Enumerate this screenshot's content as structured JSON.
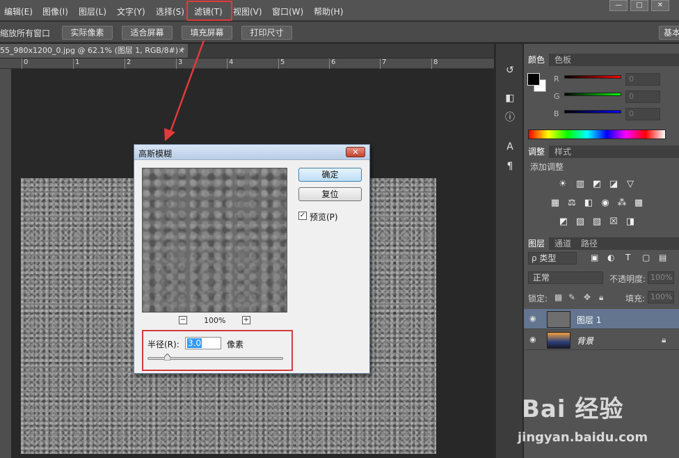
{
  "menu": {
    "items": [
      "编辑(E)",
      "图像(I)",
      "图层(L)",
      "文字(Y)",
      "选择(S)",
      "滤镜(T)",
      "视图(V)",
      "窗口(W)",
      "帮助(H)"
    ],
    "window_controls": [
      "—",
      "□",
      "✕"
    ]
  },
  "options_bar": {
    "truncated_label": "缩放所有窗口",
    "buttons": [
      "实际像素",
      "适合屏幕",
      "填充屏幕",
      "打印尺寸"
    ],
    "right_button": "基本"
  },
  "document": {
    "tab_title": "55_980x1200_0.jpg @ 62.1% (图层 1, RGB/8#) *",
    "tab_close": "×",
    "ruler_labels": [
      "0",
      "1",
      "2",
      "3",
      "4",
      "5",
      "6",
      "7",
      "8"
    ]
  },
  "dock_icons": [
    "history-icon",
    "3d-icon",
    "info-icon",
    "character-icon",
    "paragraph-icon"
  ],
  "color_panel": {
    "tabs": [
      "颜色",
      "色板"
    ],
    "channels": [
      {
        "label": "R",
        "value": "0",
        "color": "#ff0000"
      },
      {
        "label": "G",
        "value": "0",
        "color": "#00ff00"
      },
      {
        "label": "B",
        "value": "0",
        "color": "#0000ff"
      }
    ],
    "foreground": "#000000",
    "background": "#ffffff"
  },
  "adjustments_panel": {
    "tabs": [
      "调整",
      "样式"
    ],
    "title": "添加调整"
  },
  "layers_panel": {
    "tabs": [
      "图层",
      "通道",
      "路径"
    ],
    "filter_type": "ρ 类型",
    "blend_mode": "正常",
    "opacity_label": "不透明度:",
    "opacity_value": "100%",
    "lock_label": "锁定:",
    "fill_label": "填充:",
    "fill_value": "100%",
    "layers": [
      {
        "name": "图层 1",
        "selected": true,
        "locked": false
      },
      {
        "name": "背景",
        "selected": false,
        "locked": true
      }
    ]
  },
  "dialog": {
    "title": "高斯模糊",
    "close": "✕",
    "ok_label": "确定",
    "reset_label": "复位",
    "preview_label": "预览(P)",
    "preview_checked": true,
    "zoom_minus": "−",
    "zoom_plus": "+",
    "zoom_level": "100%",
    "radius_label": "半径(R):",
    "radius_value": "3.0",
    "radius_unit": "像素",
    "highlight_color": "#d43a3a"
  },
  "watermark": {
    "logo": "Bai 经验",
    "url": "jingyan.baidu.com"
  }
}
